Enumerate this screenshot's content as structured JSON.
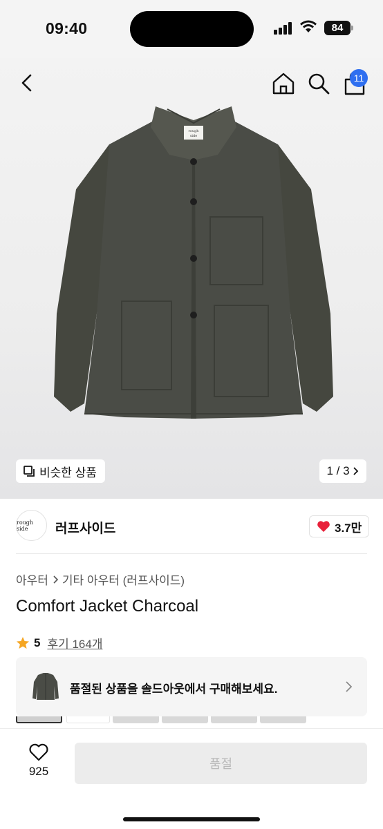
{
  "status_bar": {
    "time": "09:40",
    "battery": "84"
  },
  "nav": {
    "cart_count": "11"
  },
  "hero": {
    "similar_label": "비슷한 상품",
    "page_indicator": "1 / 3",
    "brand_tag": "rough side"
  },
  "brand": {
    "logo_text": "rough side",
    "name": "러프사이드",
    "likes": "3.7만"
  },
  "product": {
    "breadcrumb": [
      "아우터",
      "기타 아우터 (러프사이드)"
    ],
    "title": "Comfort Jacket Charcoal",
    "rating": "5",
    "reviews": "후기 164개"
  },
  "banner": {
    "text": "품절된 상품을 솔드아웃에서 구매해보세요."
  },
  "bottom": {
    "wish_count": "925",
    "buy_label": "품절"
  },
  "colors": {
    "accent_badge": "#2f6ff0",
    "heart": "#e8213a",
    "star": "#f5a623",
    "jacket": "#4a4c46"
  },
  "icons": [
    "back-arrow-icon",
    "home-icon",
    "search-icon",
    "cart-icon",
    "copy-icon",
    "chevron-right-icon",
    "heart-icon",
    "star-icon"
  ]
}
